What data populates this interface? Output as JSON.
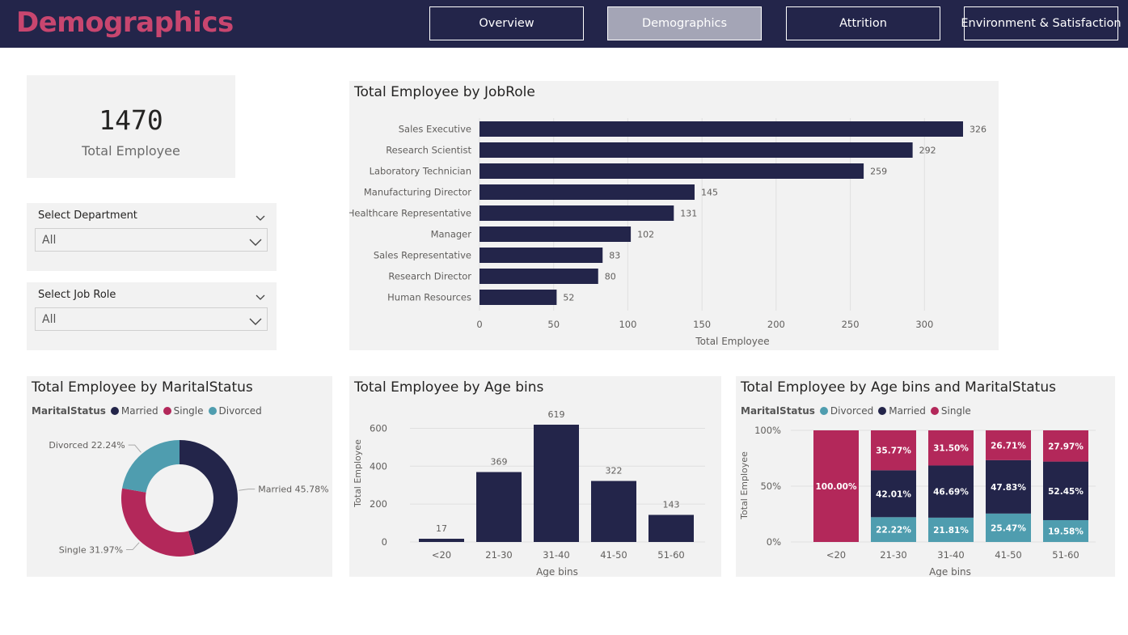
{
  "header": {
    "title": "Demographics",
    "nav": [
      {
        "label": "Overview",
        "active": false
      },
      {
        "label": "Demographics",
        "active": true
      },
      {
        "label": "Attrition",
        "active": false
      },
      {
        "label": "Environment & Satisfaction",
        "active": false
      }
    ]
  },
  "kpi": {
    "value": "1470",
    "label": "Total Employee"
  },
  "slicers": {
    "department": {
      "title": "Select Department",
      "value": "All"
    },
    "jobrole": {
      "title": "Select Job Role",
      "value": "All"
    }
  },
  "colors": {
    "navy": "#23254a",
    "crimson": "#b3285a",
    "teal": "#4f9daf",
    "accent": "#c8466f"
  },
  "icons": {
    "slicer_menu": "chevron-down-icon",
    "dropdown": "chevron-down-icon"
  },
  "chart_data": [
    {
      "id": "jobrole",
      "type": "bar",
      "orientation": "horizontal",
      "title": "Total Employee by JobRole",
      "xlabel": "Total Employee",
      "categories": [
        "Sales Executive",
        "Research Scientist",
        "Laboratory Technician",
        "Manufacturing Director",
        "Healthcare Representative",
        "Manager",
        "Sales Representative",
        "Research Director",
        "Human Resources"
      ],
      "values": [
        326,
        292,
        259,
        145,
        131,
        102,
        83,
        80,
        52
      ],
      "xticks": [
        0,
        50,
        100,
        150,
        200,
        250,
        300
      ],
      "xlim": [
        0,
        326
      ],
      "grid": true
    },
    {
      "id": "marital",
      "type": "pie",
      "donut": true,
      "title": "Total Employee by MaritalStatus",
      "legend_title": "MaritalStatus",
      "categories": [
        "Married",
        "Single",
        "Divorced"
      ],
      "values": [
        45.78,
        31.97,
        22.24
      ],
      "labels": [
        "Married 45.78%",
        "Single 31.97%",
        "Divorced 22.24%"
      ],
      "legend": "top-left"
    },
    {
      "id": "agebins",
      "type": "bar",
      "title": "Total Employee by Age bins",
      "xlabel": "Age bins",
      "ylabel": "Total Employee",
      "categories": [
        "<20",
        "21-30",
        "31-40",
        "41-50",
        "51-60"
      ],
      "values": [
        17,
        369,
        619,
        322,
        143
      ],
      "yticks": [
        0,
        200,
        400,
        600
      ],
      "ylim": [
        0,
        619
      ],
      "grid": true
    },
    {
      "id": "agemarital",
      "type": "bar",
      "stacked": "percent",
      "title": "Total Employee by Age bins and MaritalStatus",
      "legend_title": "MaritalStatus",
      "xlabel": "Age bins",
      "ylabel": "Total Employee",
      "categories": [
        "<20",
        "21-30",
        "31-40",
        "41-50",
        "51-60"
      ],
      "yticks": [
        "0%",
        "50%",
        "100%"
      ],
      "series": [
        {
          "name": "Divorced",
          "values": [
            0,
            22.22,
            21.81,
            25.47,
            19.58
          ],
          "labels": [
            "",
            "22.22%",
            "21.81%",
            "25.47%",
            "19.58%"
          ]
        },
        {
          "name": "Married",
          "values": [
            0,
            42.01,
            46.69,
            47.83,
            52.45
          ],
          "labels": [
            "",
            "42.01%",
            "46.69%",
            "47.83%",
            "52.45%"
          ]
        },
        {
          "name": "Single",
          "values": [
            100,
            35.77,
            31.5,
            26.71,
            27.97
          ],
          "labels": [
            "100.00%",
            "35.77%",
            "31.50%",
            "26.71%",
            "27.97%"
          ]
        }
      ]
    }
  ]
}
